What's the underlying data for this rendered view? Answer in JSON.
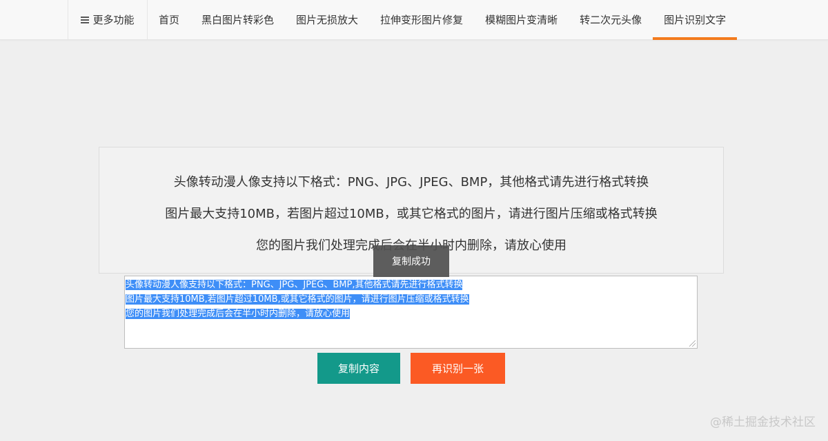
{
  "header": {
    "more_label": "更多功能",
    "nav": [
      {
        "label": "首页"
      },
      {
        "label": "黑白图片转彩色"
      },
      {
        "label": "图片无损放大"
      },
      {
        "label": "拉伸变形图片修复"
      },
      {
        "label": "模糊图片变清晰"
      },
      {
        "label": "转二次元头像"
      },
      {
        "label": "图片识别文字",
        "active": true
      }
    ],
    "active_color": "#f37b1d"
  },
  "notice": {
    "lines": [
      "头像转动漫人像支持以下格式：PNG、JPG、JPEG、BMP，其他格式请先进行格式转换",
      "图片最大支持10MB，若图片超过10MB，或其它格式的图片，请进行图片压缩或格式转换",
      "您的图片我们处理完成后会在半小时内删除，请放心使用"
    ]
  },
  "toast": {
    "text": "复制成功"
  },
  "result": {
    "lines": [
      "头像转动漫人像支持以下格式：PNG、JPG、JPEG、BMP,其他格式请先进行格式转换",
      "图片最大支持10MB,若图片超过10MB,或其它格式的图片，请进行图片压缩或格式转换",
      "您的图片我们处理完成后会在半小时内删除，请放心使用"
    ],
    "selection_color": "#3e8ef7"
  },
  "buttons": {
    "copy_label": "复制内容",
    "copy_color": "#13998a",
    "retry_label": "再识别一张",
    "retry_color": "#fb5a24"
  },
  "watermark": "@稀土掘金技术社区"
}
